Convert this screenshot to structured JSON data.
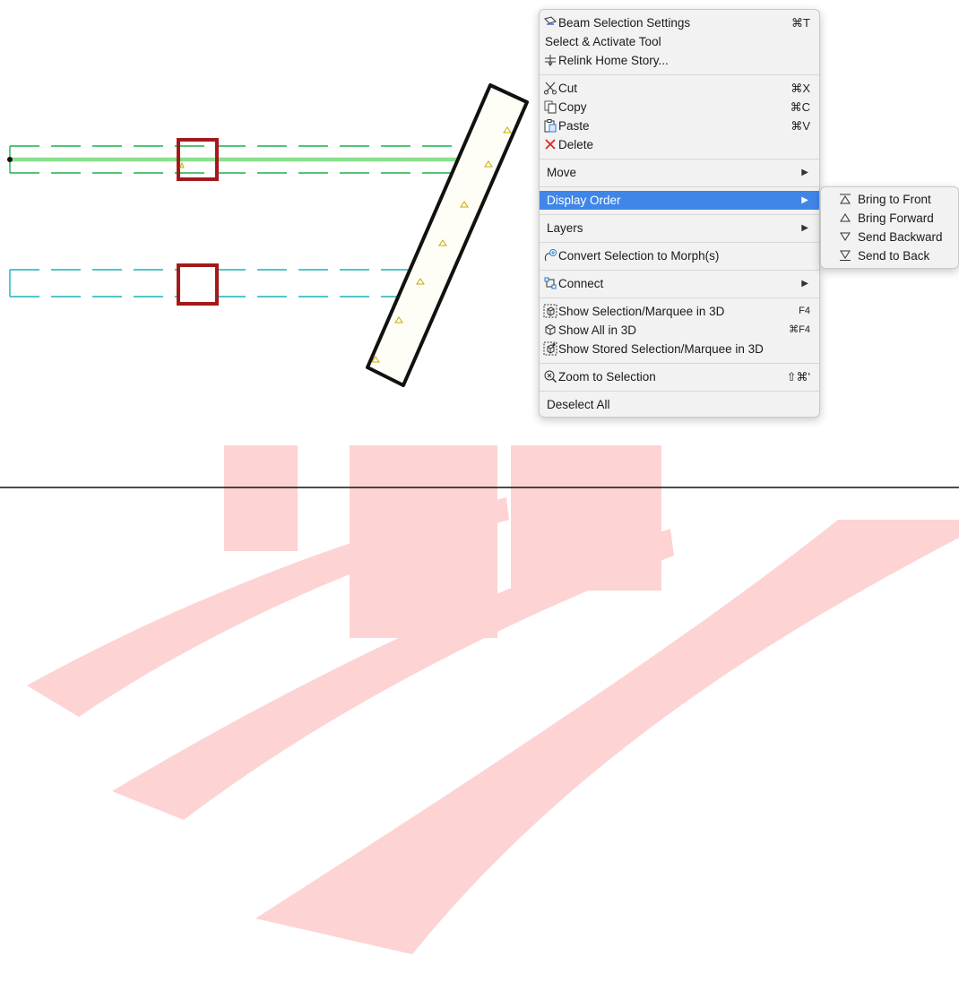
{
  "context_menu": {
    "items": [
      {
        "label": "Beam Selection Settings",
        "shortcut": "⌘T",
        "icon": "beam-settings-icon"
      },
      {
        "label": "Select & Activate Tool"
      },
      {
        "label": "Relink Home Story...",
        "icon": "relink-story-icon"
      },
      {
        "label": "Cut",
        "shortcut": "⌘X",
        "icon": "scissors-icon"
      },
      {
        "label": "Copy",
        "shortcut": "⌘C",
        "icon": "copy-icon"
      },
      {
        "label": "Paste",
        "shortcut": "⌘V",
        "icon": "paste-icon"
      },
      {
        "label": "Delete",
        "icon": "delete-x-icon"
      },
      {
        "label": "Move"
      },
      {
        "label": "Display Order"
      },
      {
        "label": "Layers"
      },
      {
        "label": "Convert Selection to Morph(s)",
        "icon": "morph-icon"
      },
      {
        "label": "Connect",
        "icon": "connect-icon"
      },
      {
        "label": "Show Selection/Marquee in 3D",
        "shortcut": "F4",
        "icon": "cube-marquee-icon"
      },
      {
        "label": "Show All in 3D",
        "shortcut": "⌘F4",
        "icon": "cube-icon"
      },
      {
        "label": "Show Stored Selection/Marquee in 3D",
        "icon": "cube-stored-icon"
      },
      {
        "label": "Zoom to Selection",
        "shortcut": "⇧⌘'",
        "icon": "zoom-selection-icon"
      },
      {
        "label": "Deselect All"
      }
    ]
  },
  "display_order_submenu": {
    "items": [
      {
        "label": "Bring to Front",
        "icon": "bring-to-front-icon"
      },
      {
        "label": "Bring Forward",
        "icon": "bring-forward-icon"
      },
      {
        "label": "Send Backward",
        "icon": "send-backward-icon"
      },
      {
        "label": "Send to Back",
        "icon": "send-to-back-icon"
      }
    ]
  },
  "colors": {
    "highlight": "#3f86e8",
    "delete_red": "#e0261b",
    "beam_green": "#1fae4f",
    "beam_cyan": "#1ab3b8",
    "column_red": "#a3191a",
    "selected_line": "#8be08b",
    "watermark": "#fdd3d3"
  }
}
